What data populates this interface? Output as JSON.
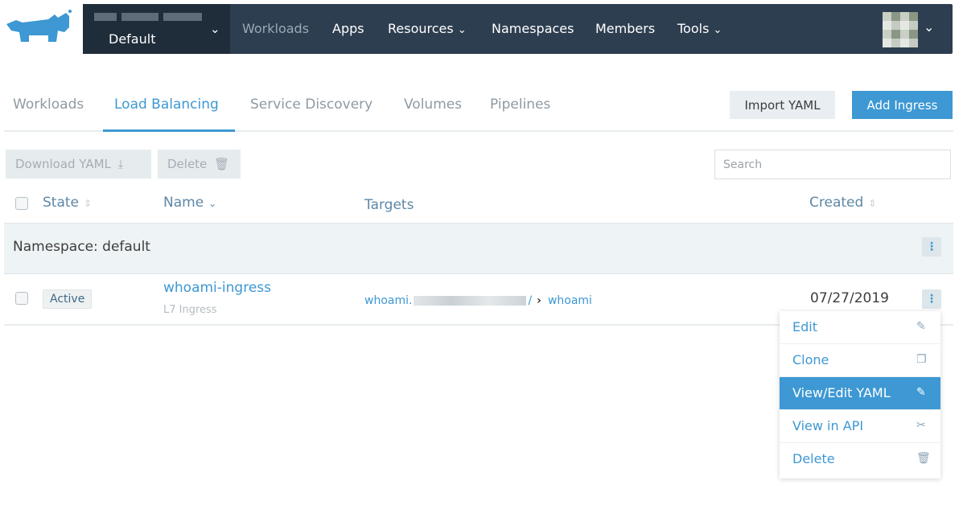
{
  "topnav": {
    "cluster_name": "Default",
    "items": [
      "Workloads",
      "Apps",
      "Resources",
      "Namespaces",
      "Members",
      "Tools"
    ],
    "dropdown_items": [
      "Resources",
      "Tools"
    ]
  },
  "subtabs": {
    "items": [
      "Workloads",
      "Load Balancing",
      "Service Discovery",
      "Volumes",
      "Pipelines"
    ],
    "active": "Load Balancing"
  },
  "actions": {
    "import_yaml": "Import YAML",
    "add_ingress": "Add Ingress",
    "download_yaml": "Download YAML",
    "delete": "Delete"
  },
  "search": {
    "placeholder": "Search",
    "value": ""
  },
  "table": {
    "headers": {
      "state": "State",
      "name": "Name",
      "targets": "Targets",
      "created": "Created"
    },
    "group_label": "Namespace: default",
    "rows": [
      {
        "state": "Active",
        "name": "whoami-ingress",
        "subtitle": "L7 Ingress",
        "target_host_prefix": "whoami.",
        "target_host_suffix": "/",
        "target_service": "whoami",
        "created": "07/27/2019"
      }
    ]
  },
  "row_menu": {
    "items": [
      {
        "label": "Edit",
        "icon": "pencil-icon"
      },
      {
        "label": "Clone",
        "icon": "copy-icon"
      },
      {
        "label": "View/Edit YAML",
        "icon": "pencil-icon"
      },
      {
        "label": "View in API",
        "icon": "wrench-icon"
      },
      {
        "label": "Delete",
        "icon": "trash-icon"
      }
    ],
    "selected": "View/Edit YAML"
  },
  "colors": {
    "nav_bg": "#2d3e50",
    "accent": "#3d98d3",
    "group_bg": "#eef3f5"
  }
}
